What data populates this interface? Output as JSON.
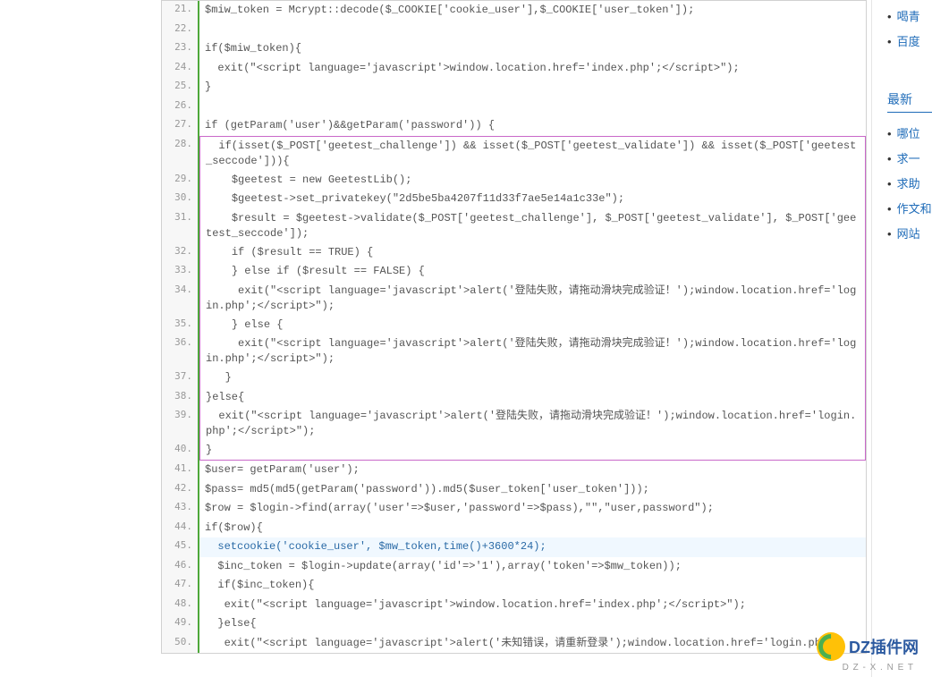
{
  "code": {
    "lines": [
      {
        "n": 21,
        "t": "$miw_token = Mcrypt::decode($_COOKIE['cookie_user'],$_COOKIE['user_token']);"
      },
      {
        "n": 22,
        "t": ""
      },
      {
        "n": 23,
        "t": "if($miw_token){"
      },
      {
        "n": 24,
        "t": "  exit(\"<script language='javascript'>window.location.href='index.php';</script>\");"
      },
      {
        "n": 25,
        "t": "}"
      },
      {
        "n": 26,
        "t": ""
      },
      {
        "n": 27,
        "t": "if (getParam('user')&&getParam('password')) {"
      },
      {
        "n": 28,
        "t": "  if(isset($_POST['geetest_challenge']) && isset($_POST['geetest_validate']) && isset($_POST['geetest_seccode'])){",
        "box": "top"
      },
      {
        "n": 29,
        "t": "    $geetest = new GeetestLib();",
        "box": "mid"
      },
      {
        "n": 30,
        "t": "    $geetest->set_privatekey(\"2d5be5ba4207f11d33f7ae5e14a1c33e\");",
        "box": "mid"
      },
      {
        "n": 31,
        "t": "    $result = $geetest->validate($_POST['geetest_challenge'], $_POST['geetest_validate'], $_POST['geetest_seccode']);",
        "box": "mid"
      },
      {
        "n": 32,
        "t": "    if ($result == TRUE) {",
        "box": "mid"
      },
      {
        "n": 33,
        "t": "    } else if ($result == FALSE) {",
        "box": "mid"
      },
      {
        "n": 34,
        "t": "     exit(\"<script language='javascript'>alert('登陆失败，请拖动滑块完成验证！');window.location.href='login.php';</script>\");",
        "box": "mid"
      },
      {
        "n": 35,
        "t": "    } else {",
        "box": "mid"
      },
      {
        "n": 36,
        "t": "     exit(\"<script language='javascript'>alert('登陆失败，请拖动滑块完成验证！');window.location.href='login.php';</script>\");",
        "box": "mid"
      },
      {
        "n": 37,
        "t": "   }",
        "box": "mid"
      },
      {
        "n": 38,
        "t": "}else{",
        "box": "mid"
      },
      {
        "n": 39,
        "t": "  exit(\"<script language='javascript'>alert('登陆失败，请拖动滑块完成验证！');window.location.href='login.php';</script>\");",
        "box": "mid"
      },
      {
        "n": 40,
        "t": "}",
        "box": "bottom"
      },
      {
        "n": 41,
        "t": "$user= getParam('user');"
      },
      {
        "n": 42,
        "t": "$pass= md5(md5(getParam('password')).md5($user_token['user_token']));"
      },
      {
        "n": 43,
        "t": "$row = $login->find(array('user'=>$user,'password'=>$pass),\"\",\"user,password\");"
      },
      {
        "n": 44,
        "t": "if($row){"
      },
      {
        "n": 45,
        "t": "  setcookie('cookie_user', $mw_token,time()+3600*24);",
        "hl": true
      },
      {
        "n": 46,
        "t": "  $inc_token = $login->update(array('id'=>'1'),array('token'=>$mw_token));"
      },
      {
        "n": 47,
        "t": "  if($inc_token){"
      },
      {
        "n": 48,
        "t": "   exit(\"<script language='javascript'>window.location.href='index.php';</script>\");"
      },
      {
        "n": 49,
        "t": "  }else{"
      },
      {
        "n": 50,
        "t": "   exit(\"<script language='javascript'>alert('未知错误，请重新登录');window.location.href='login.php';"
      }
    ]
  },
  "sidebar": {
    "top_links": [
      "喝青",
      "百度"
    ],
    "section_title": "最新",
    "links": [
      "哪位",
      "求一",
      "求助",
      "作文和主",
      "网站"
    ]
  },
  "watermark": {
    "text": "DZ插件网",
    "sub": "D Z - X . N E T"
  }
}
